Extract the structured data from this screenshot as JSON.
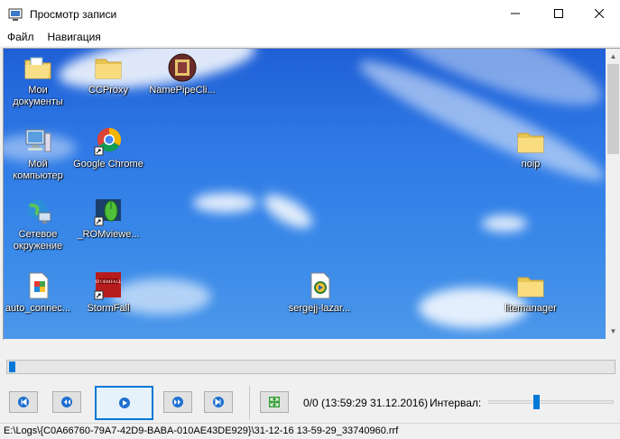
{
  "window": {
    "title": "Просмотр записи",
    "icons": {
      "app": "player-window-icon",
      "minimize": "minimize-icon",
      "maximize": "maximize-icon",
      "close": "close-icon"
    }
  },
  "menu": {
    "items": [
      {
        "label": "Файл"
      },
      {
        "label": "Навигация"
      }
    ]
  },
  "desktop": {
    "icons": [
      {
        "label": "Мои документы",
        "icon": "documents-folder-icon"
      },
      {
        "label": "CCProxy",
        "icon": "folder-icon"
      },
      {
        "label": "NamePipeCli...",
        "icon": "application-icon"
      },
      {
        "label": "Мой компьютер",
        "icon": "computer-icon"
      },
      {
        "label": "Google Chrome",
        "icon": "chrome-icon"
      },
      {
        "label": "noip",
        "icon": "folder-icon"
      },
      {
        "label": "Сетевое окружение",
        "icon": "network-icon"
      },
      {
        "label": "_ROMviewe...",
        "icon": "mouse-app-icon"
      },
      {
        "label": "auto_connec...",
        "icon": "script-file-icon"
      },
      {
        "label": "StormFall",
        "icon": "game-icon"
      },
      {
        "label": "sergejj-lazar...",
        "icon": "media-file-icon"
      },
      {
        "label": "litemanager",
        "icon": "folder-icon"
      }
    ]
  },
  "playback": {
    "progress": 0.0,
    "buttons": [
      "first-icon",
      "previous-icon",
      "play-icon",
      "next-icon",
      "last-icon",
      "fit-screen-icon"
    ],
    "position_text": "0/0 (13:59:29 31.12.2016)",
    "interval_label": "Интервал:",
    "interval_fraction": 0.38
  },
  "status": {
    "path": "E:\\Logs\\{C0A66760-79A7-42D9-BABA-010AE43DE929}\\31-12-16 13-59-29_33740960.rrf"
  },
  "colors": {
    "accent": "#0078d7",
    "desktop_sky": "#2f7ae6"
  }
}
